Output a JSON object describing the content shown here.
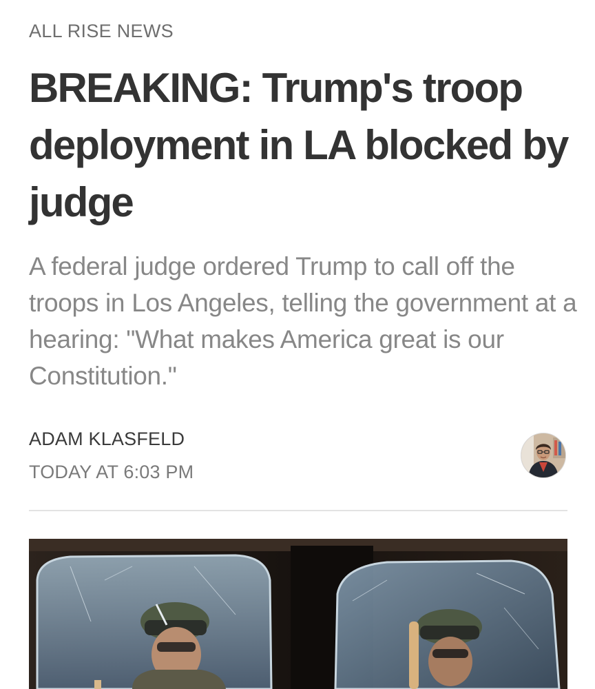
{
  "article": {
    "publication": "ALL RISE NEWS",
    "headline": "BREAKING: Trump's troop deployment in LA blocked by judge",
    "dek": "A federal judge ordered Trump to call off the troops in Los Angeles, telling the government at a hearing: \"What makes America great is our Constitution.\"",
    "author": "ADAM KLASFELD",
    "timestamp": "TODAY AT 6:03 PM"
  },
  "colors": {
    "publication": "#6e6e6e",
    "headline": "#333333",
    "dek": "#878787",
    "author": "#3a3a3a",
    "timestamp": "#7a7a7a",
    "divider": "#e3e3e3"
  }
}
